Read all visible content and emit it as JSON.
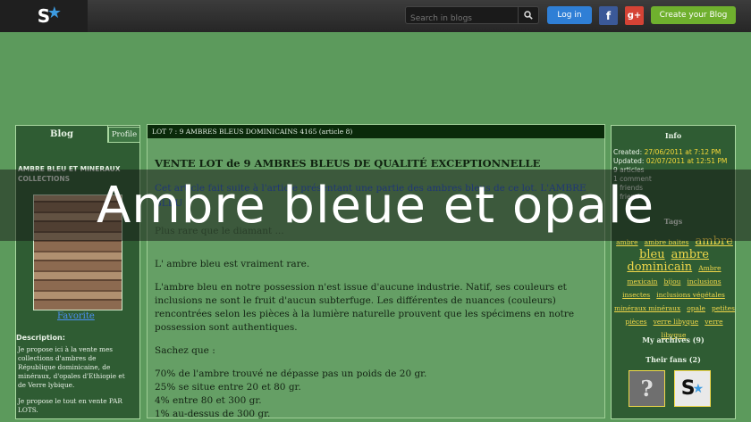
{
  "topbar": {
    "search_placeholder": "Search in blogs",
    "login_label": "Log in",
    "facebook_label": "f",
    "google_label": "g+",
    "create_label": "Create your Blog"
  },
  "tabs": {
    "blog": "Blog",
    "profile": "Profile"
  },
  "left": {
    "blog_title": "AMBRE BLEU ET MINERAUX COLLECTIONS",
    "favorite_link": "Favorite",
    "description_heading": "Description:",
    "description_p1": "Je propose ici à la vente mes collections d'ambres de République dominicaine, de minéraux, d'opales d'Ethiopie et de Verre lybique.",
    "description_p2": "Je propose le tout en vente PAR LOTS."
  },
  "article": {
    "bar": "LOT 7 : 9 AMBRES BLEUS DOMINICAINS 4165   (article 8)",
    "title": "VENTE LOT de 9 AMBRES BLEUS DE QUALITÉ EXCEPTIONNELLE",
    "intro": "Cet article fait suite à l'article présentant une partie des ambres bleus de ce lot. L'AMBRE BLEU",
    "more": "Plus rare que le diamant ...",
    "p1": "L' ambre bleu est vraiment rare.",
    "p2": "L'ambre bleu en notre possession n'est issue d'aucune industrie. Natif, ses couleurs et inclusions ne sont le fruit d'aucun subterfuge. Les différentes de nuances (couleurs) rencontrées selon les pièces à la lumière naturelle prouvent que les spécimens en notre possession sont authentiques.",
    "p3": "Sachez que :",
    "stats": [
      "70% de l'ambre trouvé ne dépasse pas un poids de 20 gr.",
      "25% se situe entre 20 et 80 gr.",
      "4% entre 80 et 300 gr.",
      "1% au-dessus de 300 gr."
    ]
  },
  "right": {
    "info_heading": "Info",
    "created_label": "Created:",
    "created_value": "27/06/2011 at 7:12 PM",
    "updated_label": "Updated:",
    "updated_value": "02/07/2011 at 12:51 PM",
    "articles": "9 articles",
    "comments": "1 comment",
    "friends": "3 friends",
    "friend": "1 friend",
    "tags_heading": "Tags",
    "tags": [
      "ambre",
      "ambre baltes",
      "ambre bleu",
      "ambre dominicain",
      "Ambre mexicain",
      "bijou",
      "inclusions insectes",
      "inclusions végétales",
      "minéraux minéraux",
      "opale",
      "petites pièces",
      "verre libyque",
      "verre libyque"
    ],
    "archives_heading": "My archives (9)",
    "fans_heading": "Their fans (2)"
  },
  "overlay": {
    "title": "Ambre bleue et opale"
  },
  "colors": {
    "background": "#5c9a5c",
    "link_blue": "#2b5ad6",
    "tag_yellow": "#f0d74a",
    "create_green": "#6fb02e"
  }
}
